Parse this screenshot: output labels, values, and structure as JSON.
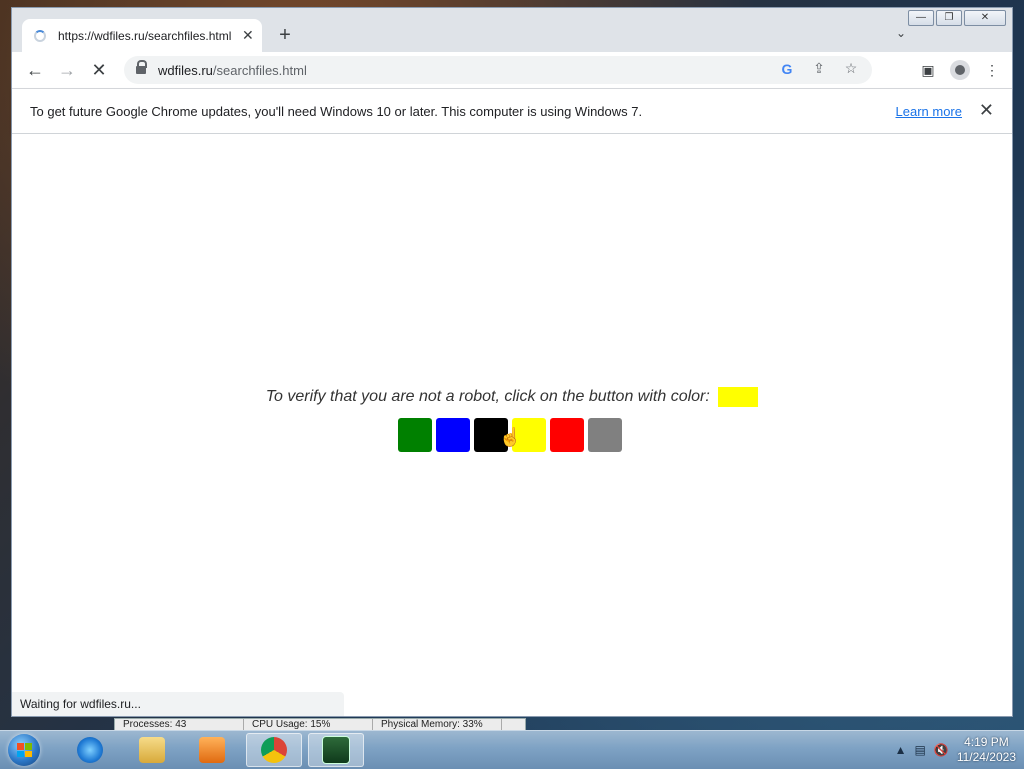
{
  "browser": {
    "tab_title": "https://wdfiles.ru/searchfiles.html",
    "tab_close": "✕",
    "new_tab": "+",
    "tab_dropdown": "⌄",
    "url_host": "wdfiles.ru",
    "url_path": "/searchfiles.html",
    "back": "←",
    "forward": "→",
    "stop": "✕",
    "google_icon": "G",
    "share_icon": "⇪",
    "star_icon": "☆",
    "sidepanel_icon": "▣",
    "menu_icon": "⋮"
  },
  "window_controls": {
    "minimize": "—",
    "maximize": "❐",
    "close": "✕"
  },
  "infobar": {
    "message": "To get future Google Chrome updates, you'll need Windows 10 or later. This computer is using Windows 7.",
    "learn_more": "Learn more",
    "close": "✕"
  },
  "captcha": {
    "prompt": "To verify that you are not a robot, click on the button with color:",
    "target_color": "#ffff00",
    "buttons": [
      {
        "name": "green",
        "color": "#008000"
      },
      {
        "name": "blue",
        "color": "#0000ff"
      },
      {
        "name": "black",
        "color": "#000000"
      },
      {
        "name": "yellow",
        "color": "#ffff00"
      },
      {
        "name": "red",
        "color": "#ff0000"
      },
      {
        "name": "gray",
        "color": "#808080"
      }
    ]
  },
  "status_bar": "Waiting for wdfiles.ru...",
  "task_manager_strip": {
    "processes": "Processes: 43",
    "cpu": "CPU Usage: 15%",
    "memory": "Physical Memory: 33%"
  },
  "taskbar": {
    "apps": [
      "internet-explorer",
      "file-explorer",
      "media-player",
      "chrome",
      "task-manager"
    ],
    "time": "4:19 PM",
    "date": "11/24/2023",
    "tray_up": "▲"
  }
}
